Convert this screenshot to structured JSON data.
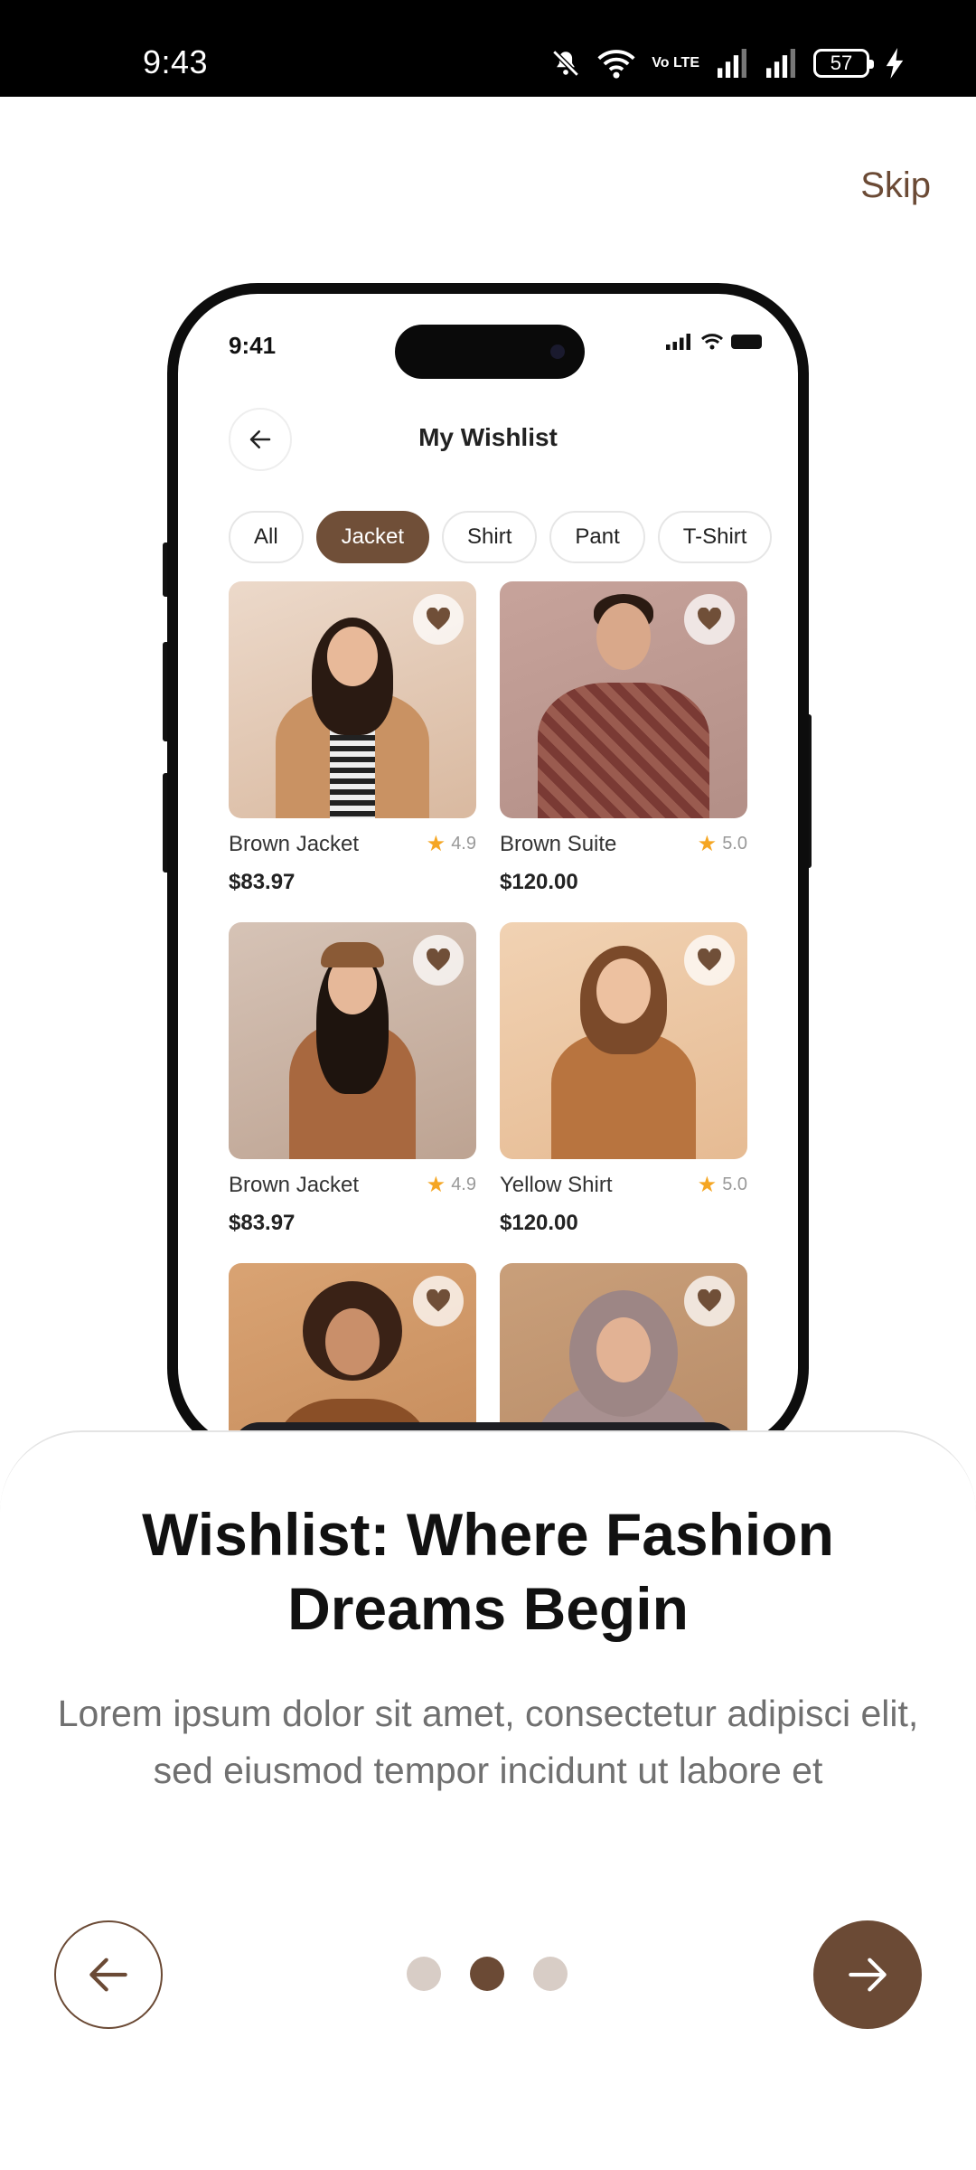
{
  "status_bar": {
    "time": "9:43",
    "battery": "57",
    "network_label": "Vo LTE",
    "icons": [
      "bell-off-icon",
      "wifi-icon",
      "volte-icon",
      "signal-icon",
      "signal-icon",
      "battery-icon",
      "charging-icon"
    ]
  },
  "skip_label": "Skip",
  "mockup": {
    "time": "9:41",
    "title": "My Wishlist",
    "chips": [
      "All",
      "Jacket",
      "Shirt",
      "Pant",
      "T-Shirt"
    ],
    "active_chip": "Jacket",
    "products": [
      {
        "name": "Brown Jacket",
        "rating": "4.9",
        "price": "$83.97"
      },
      {
        "name": "Brown Suite",
        "rating": "5.0",
        "price": "$120.00"
      },
      {
        "name": "Brown Jacket",
        "rating": "4.9",
        "price": "$83.97"
      },
      {
        "name": "Yellow Shirt",
        "rating": "5.0",
        "price": "$120.00"
      },
      {
        "name": "",
        "rating": "",
        "price": ""
      },
      {
        "name": "",
        "rating": "",
        "price": ""
      }
    ]
  },
  "onboarding": {
    "headline": "Wishlist: Where Fashion Dreams Begin",
    "description": "Lorem ipsum dolor sit amet, consectetur adipisci elit, sed eiusmod tempor incidunt ut labore et",
    "page_index": 2,
    "page_count": 3
  },
  "colors": {
    "accent": "#6B4A35",
    "chip_active": "#704F38",
    "dot_inactive": "#D8CDC6",
    "star": "#F5A623"
  }
}
